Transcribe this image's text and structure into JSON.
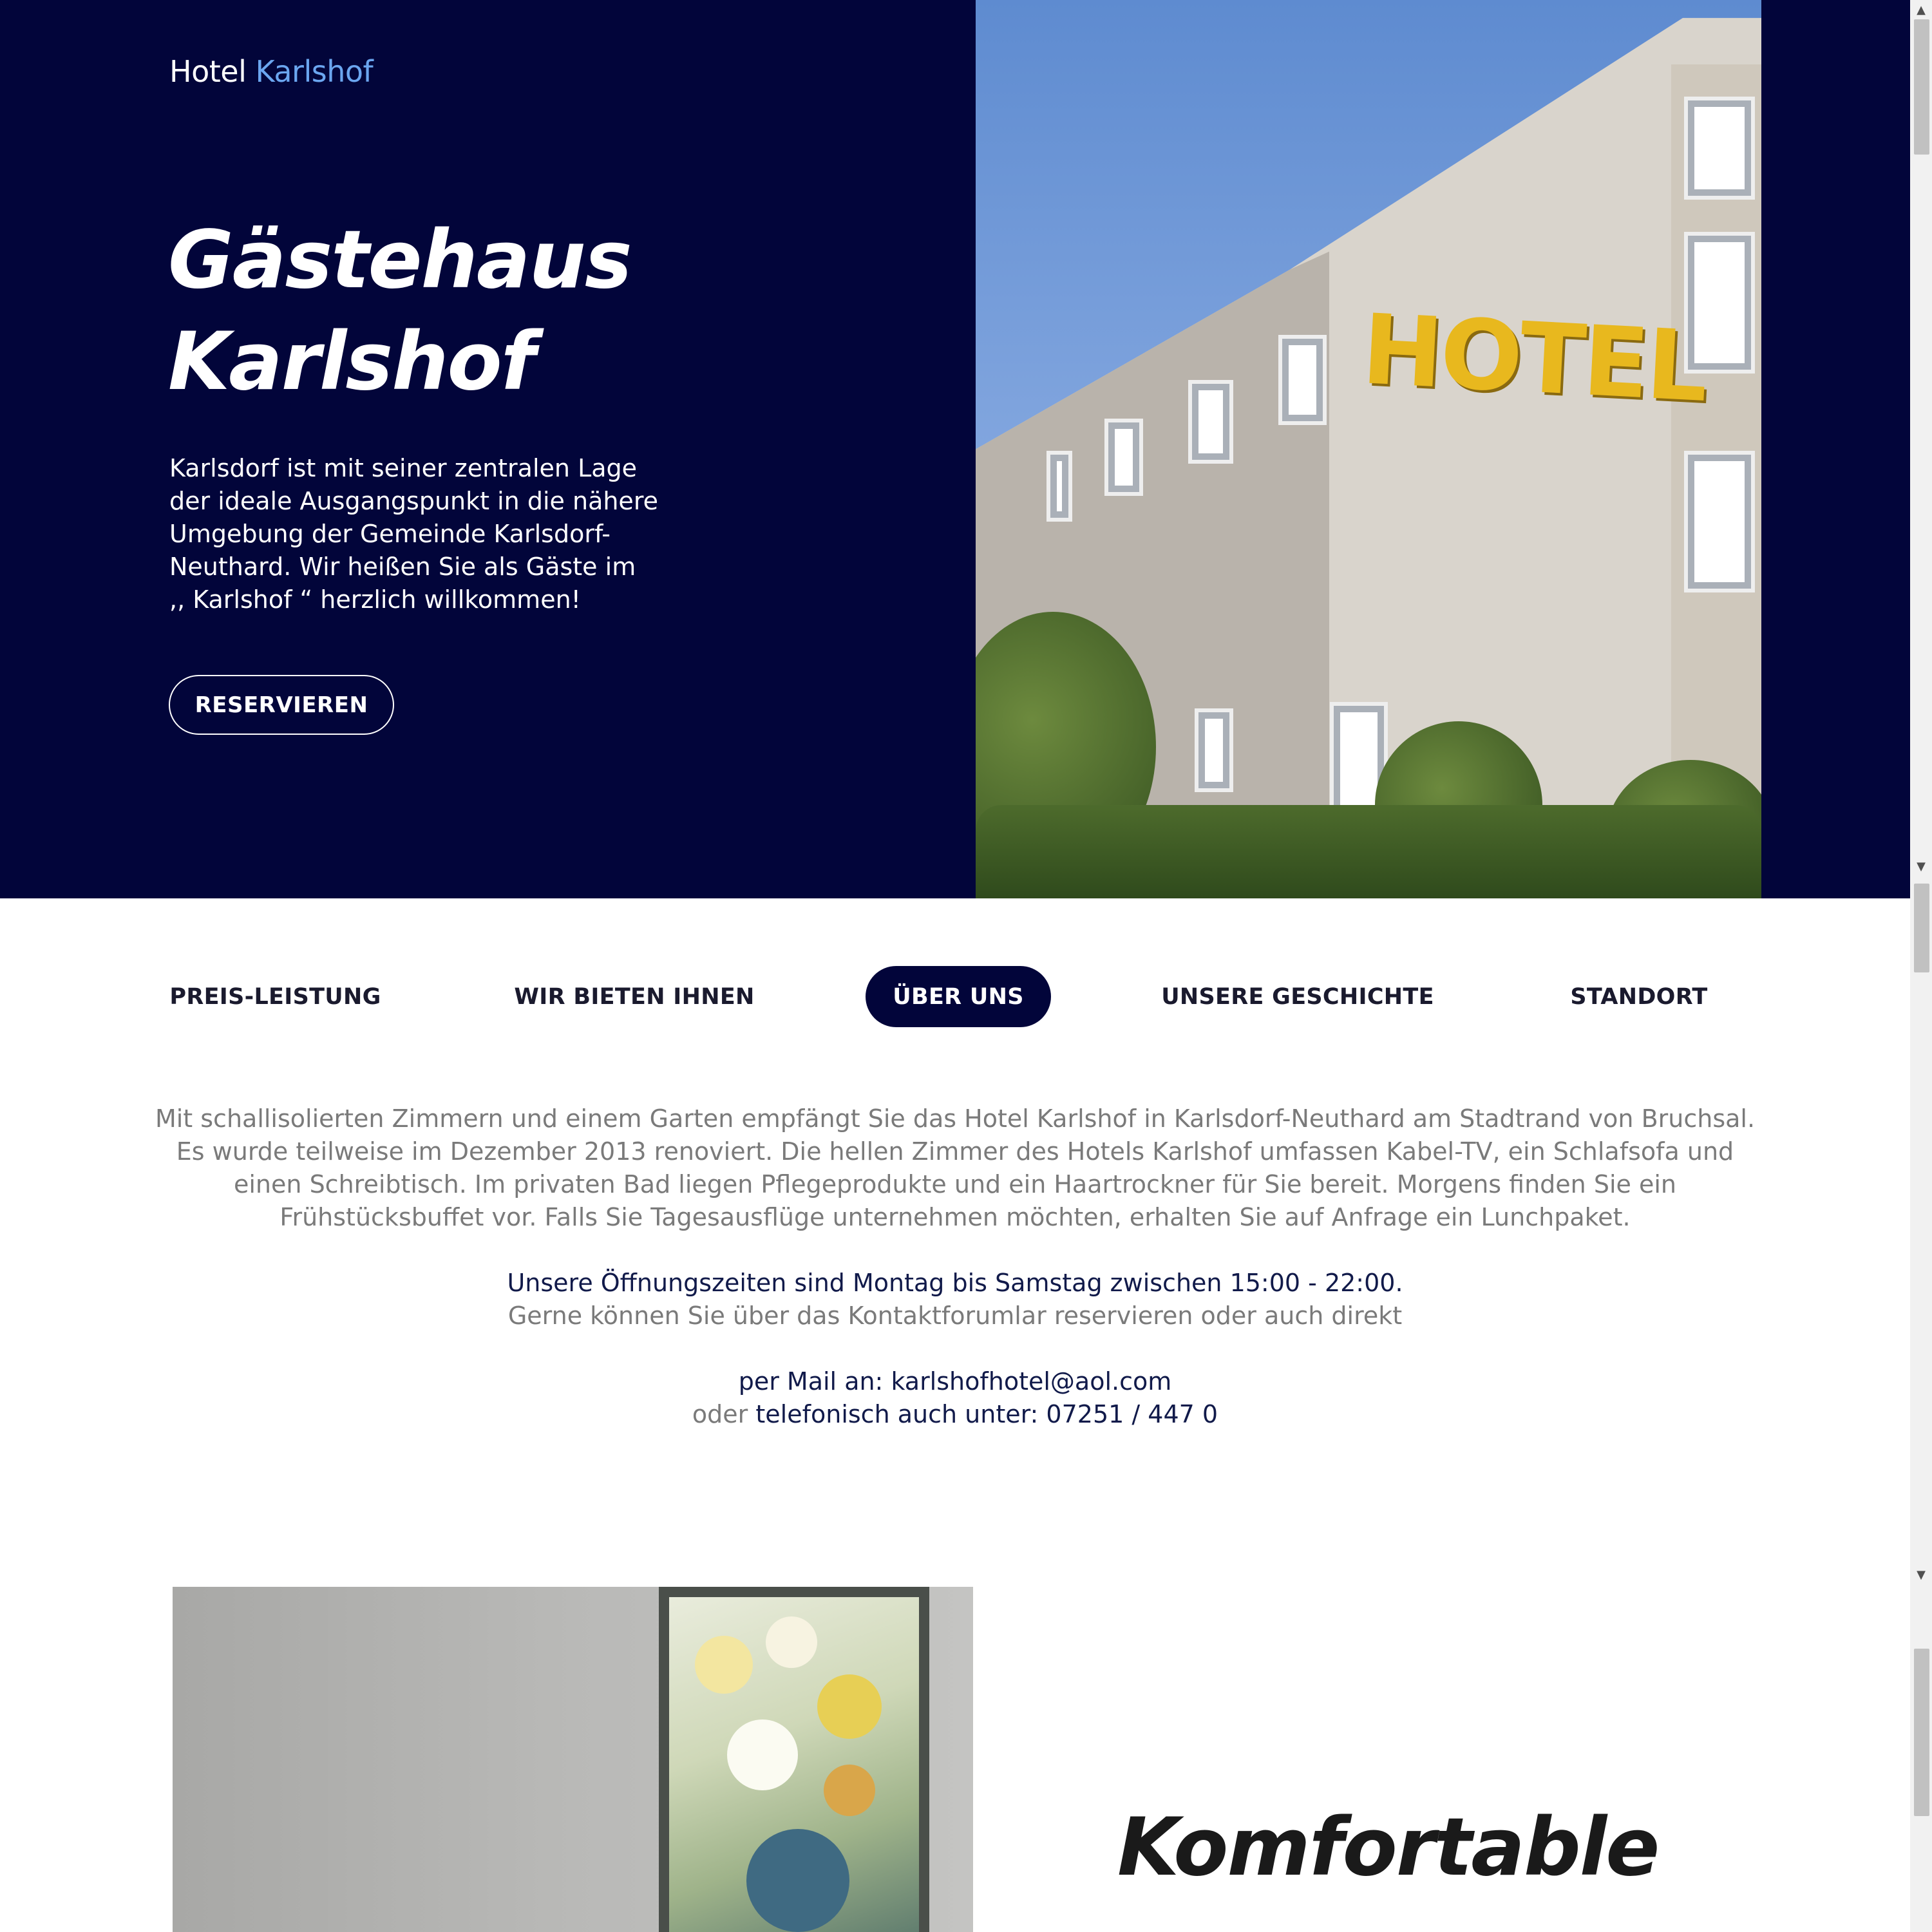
{
  "brand": {
    "name": "Hotel",
    "accent": "Karlshof"
  },
  "hero": {
    "title_line1": "Gästehaus",
    "title_line2": "Karlshof",
    "text": "Karlsdorf ist mit seiner zentralen Lage der ideale Ausgangspunkt in die nähere Umgebung der Gemeinde Karlsdorf-Neuthard. Wir heißen Sie als Gäste im ,, Karlshof “ herzlich willkommen!",
    "button": "RESERVIEREN",
    "photo_sign": "HOTEL"
  },
  "tabs": [
    {
      "label": "PREIS-LEISTUNG",
      "active": false
    },
    {
      "label": "WIR BIETEN IHNEN",
      "active": false
    },
    {
      "label": "ÜBER UNS",
      "active": true
    },
    {
      "label": "UNSERE GESCHICHTE",
      "active": false
    },
    {
      "label": "STANDORT",
      "active": false
    }
  ],
  "about": {
    "paragraph": "Mit schallisolierten Zimmern und einem Garten empfängt Sie das Hotel Karlshof in Karlsdorf-Neuthard am Stadtrand von Bruchsal. Es wurde teilweise im Dezember 2013 renoviert. Die hellen Zimmer des Hotels Karlshof umfassen Kabel-TV, ein Schlafsofa und einen Schreibtisch. Im privaten Bad liegen Pflegeprodukte und ein Haartrockner für Sie bereit. Morgens finden Sie ein Frühstücksbuffet vor. Falls Sie Tagesausflüge unternehmen möchten, erhalten Sie auf Anfrage ein Lunchpaket.",
    "hours": "Unsere Öffnungszeiten sind Montag bis Samstag zwischen 15:00 - 22:00.",
    "reserve_note": "Gerne können Sie über das Kontaktforumlar reservieren oder auch direkt",
    "mail": "per Mail an: karlshofhotel@aol.com",
    "phone_prefix": "oder",
    "phone": "telefonisch auch unter: 07251 / 447 0"
  },
  "rooms": {
    "title": "Komfortable"
  },
  "colors": {
    "navy": "#02053a",
    "accent_blue": "#6ba6f0",
    "text_gray": "#7a7a7a",
    "text_dark": "#111a4a"
  }
}
